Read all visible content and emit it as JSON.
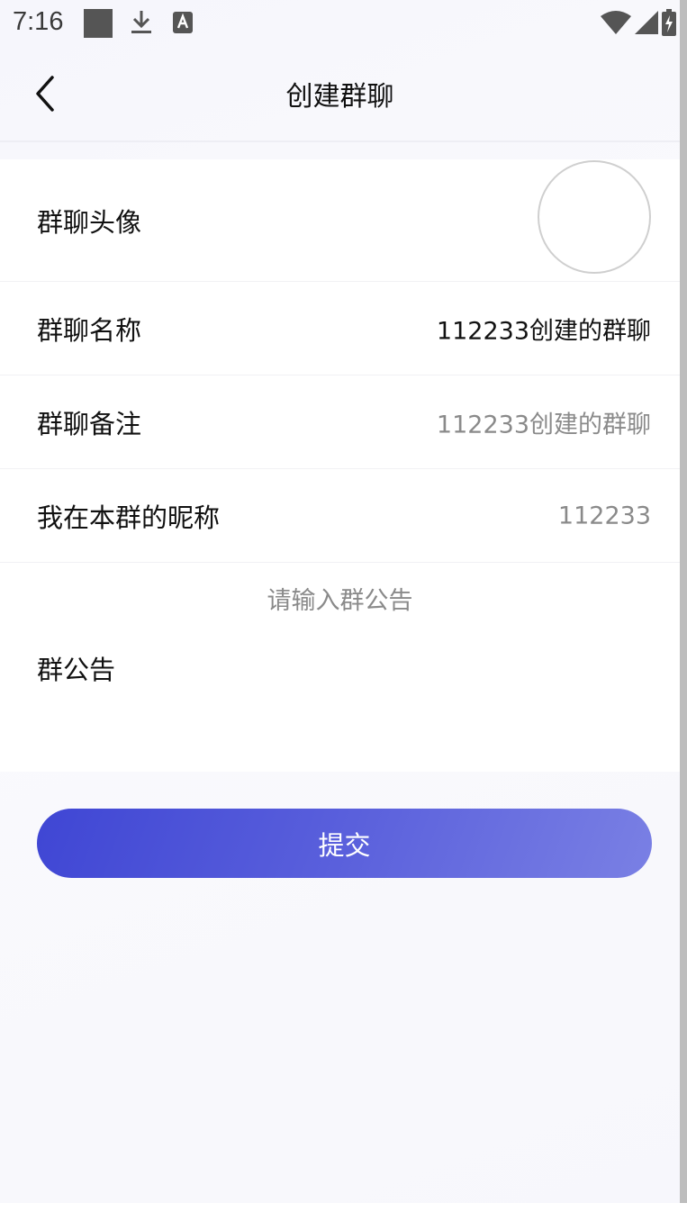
{
  "status_bar": {
    "time": "7:16",
    "icons": [
      "square-icon",
      "download-icon",
      "text-a-icon",
      "wifi-icon",
      "signal-icon",
      "battery-charging-icon"
    ]
  },
  "header": {
    "title": "创建群聊",
    "back_icon": "chevron-left-icon"
  },
  "form": {
    "avatar_label": "群聊头像",
    "name_label": "群聊名称",
    "name_value": "112233创建的群聊",
    "remark_label": "群聊备注",
    "remark_placeholder": "112233创建的群聊",
    "nickname_label": "我在本群的昵称",
    "nickname_placeholder": "112233",
    "notice_placeholder": "请输入群公告",
    "notice_label": "群公告"
  },
  "submit": {
    "label": "提交"
  },
  "colors": {
    "accent_start": "#3f46d4",
    "accent_end": "#7a80e4",
    "muted_text": "#8a8a8a"
  }
}
